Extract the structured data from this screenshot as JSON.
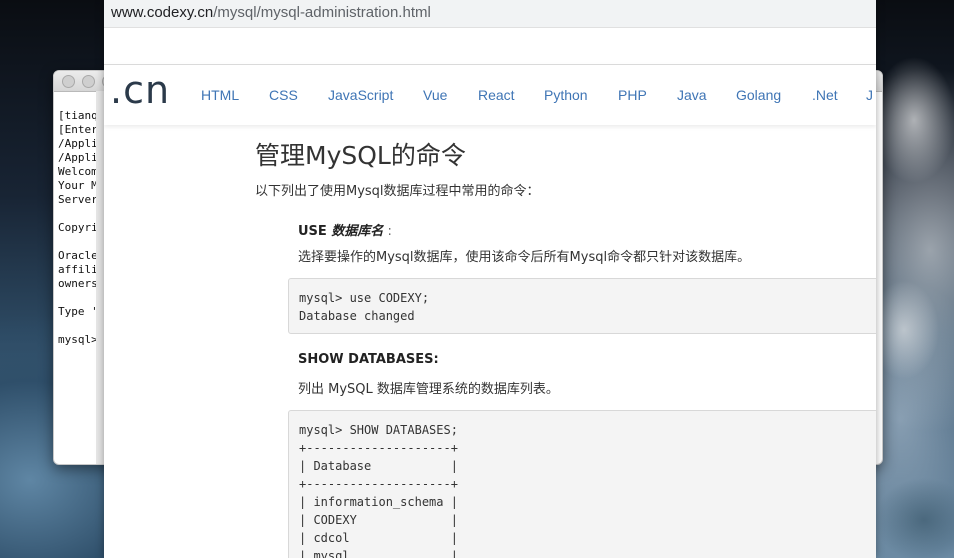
{
  "terminal": {
    "lines": [
      "[tianqix",
      "[Enter p",
      "/Applic",
      "/Applic",
      "Welcome",
      "Your My",
      "Server",
      "",
      "Copyrig",
      "",
      "Oracle",
      "affilia",
      "owners.",
      "",
      "Type 'h",
      "",
      "mysql>"
    ]
  },
  "browser": {
    "url_host": "www.codexy.cn",
    "url_path": "/mysql/mysql-administration.html",
    "logo": ".cn",
    "nav": [
      "HTML",
      "CSS",
      "JavaScript",
      "Vue",
      "React",
      "Python",
      "PHP",
      "Java",
      "Golang",
      ".Net",
      "J"
    ]
  },
  "article": {
    "title": "管理MySQL的命令",
    "intro": "以下列出了使用Mysql数据库过程中常用的命令：",
    "cmd1": {
      "keyword": "USE ",
      "param": "数据库名",
      "colon": " :",
      "desc": "选择要操作的Mysql数据库，使用该命令后所有Mysql命令都只针对该数据库。",
      "code": "mysql> use CODEXY;\nDatabase changed"
    },
    "cmd2": {
      "title": "SHOW DATABASES:",
      "desc": "列出 MySQL 数据库管理系统的数据库列表。",
      "code": "mysql> SHOW DATABASES;\n+--------------------+\n| Database           |\n+--------------------+\n| information_schema |\n| CODEXY             |\n| cdcol              |\n| mysql              |"
    }
  }
}
